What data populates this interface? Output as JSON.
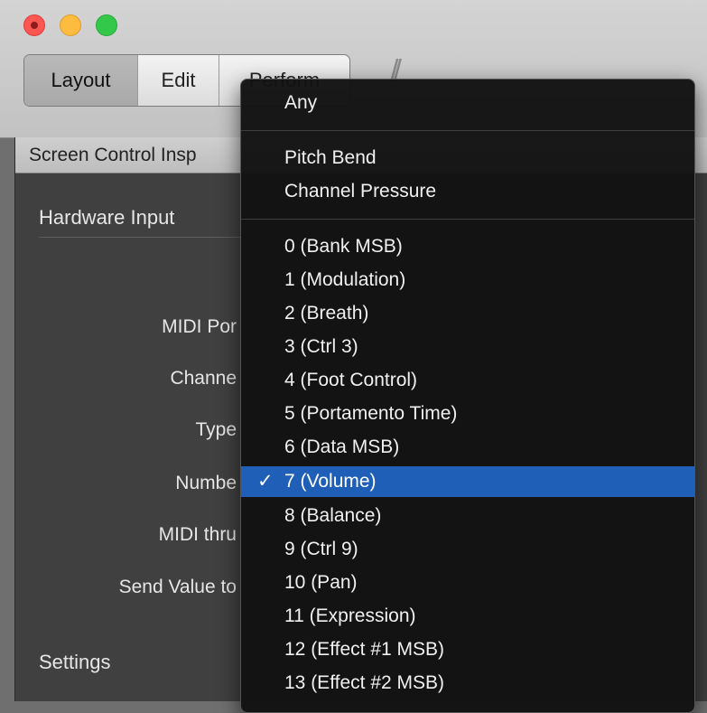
{
  "window": {
    "toolbar_tabs": [
      {
        "label": "Layout",
        "active": true
      },
      {
        "label": "Edit",
        "active": false
      },
      {
        "label": "Perform",
        "active": false
      }
    ]
  },
  "inspector": {
    "title": "Screen Control Insp",
    "hardware_section": "Hardware Input",
    "settings_section": "Settings",
    "labels": [
      "MIDI Por",
      "Channe",
      "Type",
      "Numbe",
      "MIDI thru",
      "Send Value to"
    ]
  },
  "menu": {
    "group1": [
      "Any"
    ],
    "group2": [
      "Pitch Bend",
      "Channel Pressure"
    ],
    "items": [
      "0 (Bank MSB)",
      "1 (Modulation)",
      "2 (Breath)",
      "3 (Ctrl 3)",
      "4 (Foot Control)",
      "5 (Portamento Time)",
      "6 (Data MSB)",
      "7 (Volume)",
      "8 (Balance)",
      "9 (Ctrl 9)",
      "10 (Pan)",
      "11 (Expression)",
      "12 (Effect #1 MSB)",
      "13 (Effect #2 MSB)"
    ],
    "selected_index": 7,
    "checkmark": "✓"
  }
}
